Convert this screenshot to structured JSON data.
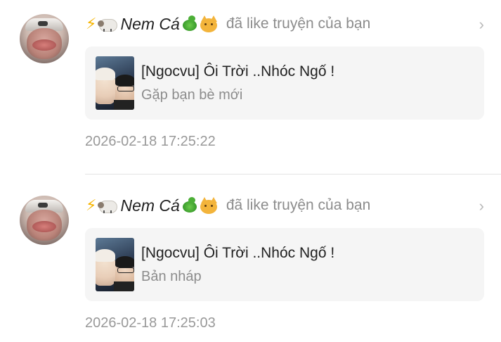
{
  "notifications": [
    {
      "username": "Nem Cá",
      "action": "đã like truyện của bạn",
      "story_title": "[Ngocvu] Ôi Trời ..Nhóc Ngố !",
      "chapter": "Gặp bạn bè mới",
      "timestamp": "2026-02-18 17:25:22",
      "icons": [
        "lightning-icon",
        "sheep-icon",
        "snake-icon",
        "cat-icon",
        "chevron-right-icon"
      ]
    },
    {
      "username": "Nem Cá",
      "action": "đã like truyện của bạn",
      "story_title": "[Ngocvu] Ôi Trời ..Nhóc Ngố !",
      "chapter": "Bản nháp",
      "timestamp": "2026-02-18 17:25:03",
      "icons": [
        "lightning-icon",
        "sheep-icon",
        "snake-icon",
        "cat-icon",
        "chevron-right-icon"
      ]
    }
  ],
  "colors": {
    "primary_text": "#222222",
    "secondary_text": "#8c8c8c",
    "timestamp_text": "#999999",
    "card_background": "#f5f5f5",
    "divider": "#e3e3e3",
    "chevron": "#b8b8b8"
  }
}
